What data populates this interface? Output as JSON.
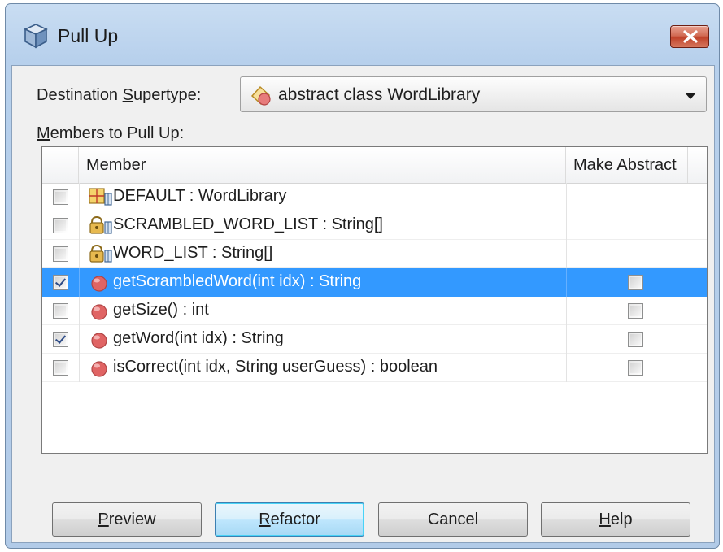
{
  "window": {
    "title": "Pull Up",
    "close_glyph": "✕"
  },
  "destination": {
    "label_pre": "Destination ",
    "label_mnemonic": "S",
    "label_post": "upertype:",
    "selected_value": "abstract class WordLibrary",
    "icon": "abstract-class-icon"
  },
  "members": {
    "label_mnemonic": "M",
    "label_post": "embers to Pull Up:",
    "columns": [
      "Member",
      "Make Abstract"
    ],
    "rows": [
      {
        "name": "DEFAULT : WordLibrary",
        "icon": "static-field-icon",
        "checked": false,
        "make_abstract": null,
        "selected": false
      },
      {
        "name": "SCRAMBLED_WORD_LIST : String[]",
        "icon": "private-static-field-icon",
        "checked": false,
        "make_abstract": null,
        "selected": false
      },
      {
        "name": "WORD_LIST : String[]",
        "icon": "private-static-field-icon",
        "checked": false,
        "make_abstract": null,
        "selected": false
      },
      {
        "name": "getScrambledWord(int idx) : String",
        "icon": "method-icon",
        "checked": true,
        "make_abstract": false,
        "selected": true
      },
      {
        "name": "getSize() : int",
        "icon": "method-icon",
        "checked": false,
        "make_abstract": false,
        "selected": false
      },
      {
        "name": "getWord(int idx) : String",
        "icon": "method-icon",
        "checked": true,
        "make_abstract": false,
        "selected": false
      },
      {
        "name": "isCorrect(int idx, String userGuess) : boolean",
        "icon": "method-icon",
        "checked": false,
        "make_abstract": false,
        "selected": false
      }
    ]
  },
  "buttons": {
    "preview": {
      "mnemonic": "P",
      "rest": "review"
    },
    "refactor": {
      "mnemonic": "R",
      "rest": "efactor"
    },
    "cancel": {
      "label": "Cancel"
    },
    "help": {
      "mnemonic": "H",
      "rest": "elp"
    }
  },
  "colors": {
    "selection": "#3399ff",
    "method_icon": "#e06464",
    "title_bar": "#b9d1ea"
  }
}
